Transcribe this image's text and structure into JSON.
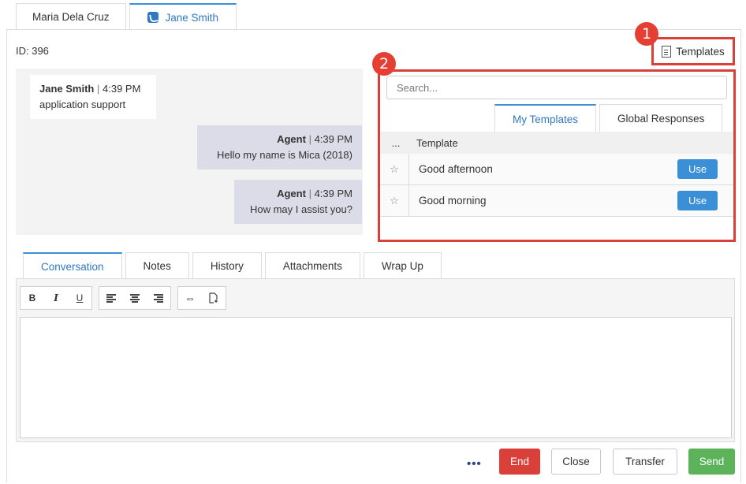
{
  "contact_tabs": [
    {
      "label": "Maria Dela Cruz"
    },
    {
      "label": "Jane Smith"
    }
  ],
  "id_label": "ID: 396",
  "templates_button": {
    "label": "Templates"
  },
  "badges": {
    "one": "1",
    "two": "2"
  },
  "messages": [
    {
      "sender": "Jane Smith",
      "separator": "|",
      "time": "4:39 PM",
      "text": "application support"
    },
    {
      "sender": "Agent",
      "separator": "|",
      "time": "4:39 PM",
      "text": "Hello my name is Mica (2018)"
    },
    {
      "sender": "Agent",
      "separator": "|",
      "time": "4:39 PM",
      "text": "How may I assist you?"
    }
  ],
  "templates_panel": {
    "search_placeholder": "Search...",
    "tabs": [
      {
        "label": "My Templates"
      },
      {
        "label": "Global Responses"
      }
    ],
    "header": {
      "col1": "...",
      "col2": "Template"
    },
    "rows": [
      {
        "name": "Good afternoon",
        "use_label": "Use"
      },
      {
        "name": "Good morning",
        "use_label": "Use"
      }
    ],
    "star_glyph": "☆"
  },
  "bottom_tabs": [
    {
      "label": "Conversation"
    },
    {
      "label": "Notes"
    },
    {
      "label": "History"
    },
    {
      "label": "Attachments"
    },
    {
      "label": "Wrap Up"
    }
  ],
  "toolbar": {
    "bold": "B",
    "italic": "I",
    "underline": "U",
    "link_glyph": "⇔"
  },
  "actions": {
    "more": "•••",
    "end": "End",
    "close": "Close",
    "transfer": "Transfer",
    "send": "Send"
  },
  "colors": {
    "accent": "#3b8fd6",
    "danger": "#d9403a",
    "success": "#5cb35a",
    "highlight": "#e53e33"
  }
}
